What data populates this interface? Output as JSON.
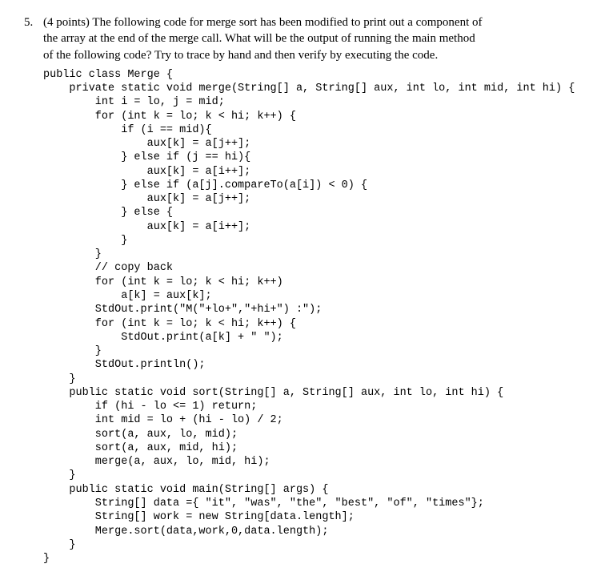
{
  "problem": {
    "number": "5.",
    "points": "(4 points)",
    "prompt_line1": "The following code for merge sort has been modified to print out a component of",
    "prompt_line2": "the array at the end of the merge call. What will be the output of running the main method",
    "prompt_line3": "of the following code? Try to trace by hand and then verify by executing the code."
  },
  "code": {
    "l01": "public class Merge {",
    "l02": "    private static void merge(String[] a, String[] aux, int lo, int mid, int hi) {",
    "l03": "        int i = lo, j = mid;",
    "l04": "        for (int k = lo; k < hi; k++) {",
    "l05": "            if (i == mid){",
    "l06": "                aux[k] = a[j++];",
    "l07": "            } else if (j == hi){",
    "l08": "                aux[k] = a[i++];",
    "l09": "            } else if (a[j].compareTo(a[i]) < 0) {",
    "l10": "                aux[k] = a[j++];",
    "l11": "            } else {",
    "l12": "                aux[k] = a[i++];",
    "l13": "            }",
    "l14": "        }",
    "l15": "        // copy back",
    "l16": "        for (int k = lo; k < hi; k++)",
    "l17": "            a[k] = aux[k];",
    "l18": "        StdOut.print(\"M(\"+lo+\",\"+hi+\") :\");",
    "l19": "        for (int k = lo; k < hi; k++) {",
    "l20": "            StdOut.print(a[k] + \" \");",
    "l21": "        }",
    "l22": "        StdOut.println();",
    "l23": "    }",
    "l24": "    public static void sort(String[] a, String[] aux, int lo, int hi) {",
    "l25": "        if (hi - lo <= 1) return;",
    "l26": "        int mid = lo + (hi - lo) / 2;",
    "l27": "        sort(a, aux, lo, mid);",
    "l28": "        sort(a, aux, mid, hi);",
    "l29": "        merge(a, aux, lo, mid, hi);",
    "l30": "    }",
    "l31": "    public static void main(String[] args) {",
    "l32": "        String[] data ={ \"it\", \"was\", \"the\", \"best\", \"of\", \"times\"};",
    "l33": "        String[] work = new String[data.length];",
    "l34": "        Merge.sort(data,work,0,data.length);",
    "l35": "    }",
    "l36": "}"
  }
}
